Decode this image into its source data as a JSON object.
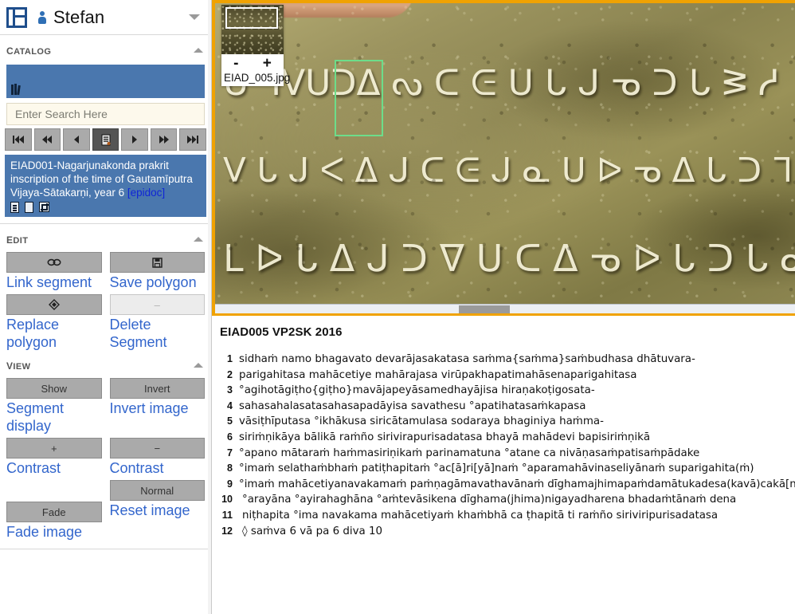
{
  "header": {
    "logo_icon": "panel-layout-icon",
    "user_icon": "person-icon",
    "user_name": "Stefan",
    "collapse_icon": "chevron-down-icon"
  },
  "sidebar": {
    "catalog": {
      "title": "Catalog",
      "collapse_icon": "chevron-up-icon",
      "toolbar_icon": "books-icon",
      "search": {
        "value": "",
        "placeholder": "Enter Search Here"
      },
      "nav_buttons": [
        {
          "name": "first-record-button",
          "icon": "skip-to-first-icon",
          "active": false
        },
        {
          "name": "fast-back-button",
          "icon": "rewind-icon",
          "active": false
        },
        {
          "name": "previous-record-button",
          "icon": "play-back-icon",
          "active": false
        },
        {
          "name": "record-list-button",
          "icon": "record-list-icon",
          "active": true
        },
        {
          "name": "next-record-button",
          "icon": "play-forward-icon",
          "active": false
        },
        {
          "name": "fast-forward-button",
          "icon": "forward-icon",
          "active": false
        },
        {
          "name": "last-record-button",
          "icon": "skip-to-last-icon",
          "active": false
        }
      ],
      "record": {
        "text": "EIAD001-Nagarjunakonda prakrit inscription of the time of Gautamīputra Vijaya-Sātakarṇi, year 6 ",
        "link_label": "[epidoc]",
        "icons": [
          "document-lines-icon",
          "blank-page-icon",
          "expand-square-icon"
        ]
      }
    },
    "edit": {
      "title": "Edit",
      "collapse_icon": "chevron-up-icon",
      "buttons": [
        {
          "name": "link-segment-button",
          "glyph": "∞",
          "icon": "link-icon",
          "label": "Link segment",
          "disabled": false
        },
        {
          "name": "save-polygon-button",
          "glyph": "💾",
          "icon": "save-icon",
          "label": "Save polygon",
          "disabled": false
        },
        {
          "name": "replace-polygon-button",
          "glyph": "◈",
          "icon": "diamond-icon",
          "label": "Replace polygon",
          "disabled": false
        },
        {
          "name": "delete-segment-button",
          "glyph": "–",
          "icon": "minus-icon",
          "label": "Delete Segment",
          "disabled": true
        }
      ]
    },
    "view": {
      "title": "View",
      "collapse_icon": "chevron-up-icon",
      "buttons": [
        {
          "name": "segment-display-button",
          "glyph": "Show",
          "label": "Segment display"
        },
        {
          "name": "invert-image-button",
          "glyph": "Invert",
          "label": "Invert image"
        },
        {
          "name": "contrast-up-button",
          "glyph": "+",
          "label": "Contrast"
        },
        {
          "name": "contrast-down-button",
          "glyph": "−",
          "label": "Contrast"
        },
        {
          "name": "fade-image-button",
          "glyph": "Fade",
          "label": "Fade image"
        },
        {
          "name": "reset-image-button",
          "glyph": "Normal",
          "label": "Reset image"
        }
      ]
    }
  },
  "viewer": {
    "navigator": {
      "filename": "EIAD_005.jpg",
      "zoom_out_label": "-",
      "zoom_in_label": "+"
    },
    "selection_color": "#6ddd8a",
    "border_color": "#f0a202",
    "glyph_rows": [
      "ᑌ ᒣᐯᑌᑐᐃ ᔓ ᑕ ᕮ ᑌ ᒐ ᒍ ᓀ ᑐ ᒐ ᕒ ᓱ",
      "ᐯ ᒐ ᒍ ᐸ ᐃ ᒍ ᑕ ᕮ ᒍ ᓇ ᑌ ᐅ ᓀ ᐃ ᒐ ᑐ ᒣ ᐃ ᓂ",
      "ᒪ ᐅ ᒐ ᐃ ᒍ ᑐ ᐁ ᑌ ᑕ ᐃ ᓀ ᐅ ᒐ ᑐ ᒐ ᓇ ᐃ"
    ]
  },
  "transcript": {
    "title": "EIAD005 VP2SK 2016",
    "lines": [
      {
        "n": "1",
        "text": "sidhaṁ namo bhagavato devarājasakatasa saṁma{saṁma}saṁbudhasa dhātuvara-"
      },
      {
        "n": "2",
        "text": "parigahitasa mahācetiye mahārajasa virūpakhapatimahāsenaparigahitasa"
      },
      {
        "n": "3",
        "text": "°agihotāgiṭho{giṭho}mavājapeyāsamedhayājisa hiraṇakoṭigosata-"
      },
      {
        "n": "4",
        "text": "sahasahalasatasahasapadāyisa savathesu °apatihatasaṁkapasa"
      },
      {
        "n": "5",
        "text": "vāsiṭhīputasa °ikhākusa siricātamulasa sodaraya bhaginiya haṁma-"
      },
      {
        "n": "6",
        "text": "siriṁṇikāya bālikā raṁño sirivirapurisadatasa bhayā mahādevi bapisiriṁṇikā"
      },
      {
        "n": "7",
        "text": "°apano mātaraṁ haṁmasiriṇikaṁ parinamatuna °atane ca nivāṇasaṁpatisaṁpādake"
      },
      {
        "n": "8",
        "text": "°imaṁ selathaṁbhaṁ patiṭhapitaṁ °ac[ā]ri[yā]naṁ °aparamahāvinaseliyānaṁ suparigahita(ṁ)"
      },
      {
        "n": "9",
        "text": "°imaṁ mahācetiyanavakamaṁ paṁṇagāmavathavānaṁ dīghamajhimapaṁdamātukadesa(kavā)cakā[naṁ]"
      },
      {
        "n": "10",
        "text": "°arayāna °ayirahaghāna °aṁtevāsikena dīghama(jhima)nigayadharena bhadaṁtānaṁ dena"
      },
      {
        "n": "11",
        "text": "niṭhapita °ima navakama mahācetiyaṁ khaṁbhā ca ṭhapitā ti raṁño siriviripurisadatasa"
      },
      {
        "n": "12",
        "text": "◊ saṁva 6 vā pa 6 diva 10"
      }
    ]
  }
}
